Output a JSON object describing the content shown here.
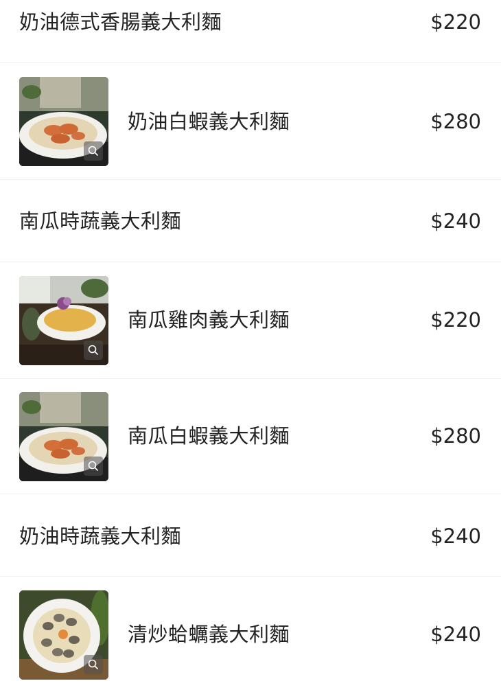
{
  "menu": {
    "items": [
      {
        "name": "奶油德式香腸義大利麵",
        "price": "$220",
        "has_photo": false
      },
      {
        "name": "奶油白蝦義大利麵",
        "price": "$280",
        "has_photo": true,
        "photo_icon": "zoom-icon"
      },
      {
        "name": "南瓜時蔬義大利麵",
        "price": "$240",
        "has_photo": false
      },
      {
        "name": "南瓜雞肉義大利麵",
        "price": "$220",
        "has_photo": true,
        "photo_icon": "zoom-icon"
      },
      {
        "name": "南瓜白蝦義大利麵",
        "price": "$280",
        "has_photo": true,
        "photo_icon": "zoom-icon"
      },
      {
        "name": "奶油時蔬義大利麵",
        "price": "$240",
        "has_photo": false
      },
      {
        "name": "清炒蛤蠣義大利麵",
        "price": "$240",
        "has_photo": true,
        "photo_icon": "zoom-icon"
      }
    ]
  },
  "colors": {
    "text": "#222222",
    "divider": "#f0f0f0",
    "background": "#ffffff"
  }
}
